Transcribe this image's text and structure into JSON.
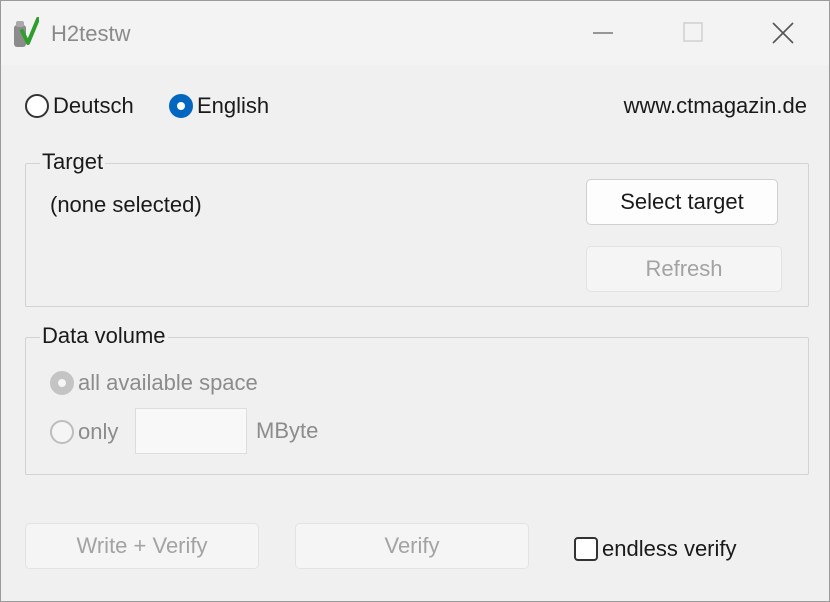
{
  "window": {
    "title": "H2testw"
  },
  "language": {
    "deutsch_label": "Deutsch",
    "english_label": "English",
    "selected": "English"
  },
  "website": "www.ctmagazin.de",
  "target": {
    "group_label": "Target",
    "selected_text": "(none selected)",
    "select_button": "Select target",
    "refresh_button": "Refresh"
  },
  "data_volume": {
    "group_label": "Data volume",
    "all_space_label": "all available space",
    "only_label": "only",
    "only_value": "",
    "unit": "MByte"
  },
  "actions": {
    "write_verify": "Write + Verify",
    "verify": "Verify",
    "endless_verify_label": "endless verify",
    "endless_verify_checked": false
  },
  "colors": {
    "accent": "#0067c0"
  }
}
